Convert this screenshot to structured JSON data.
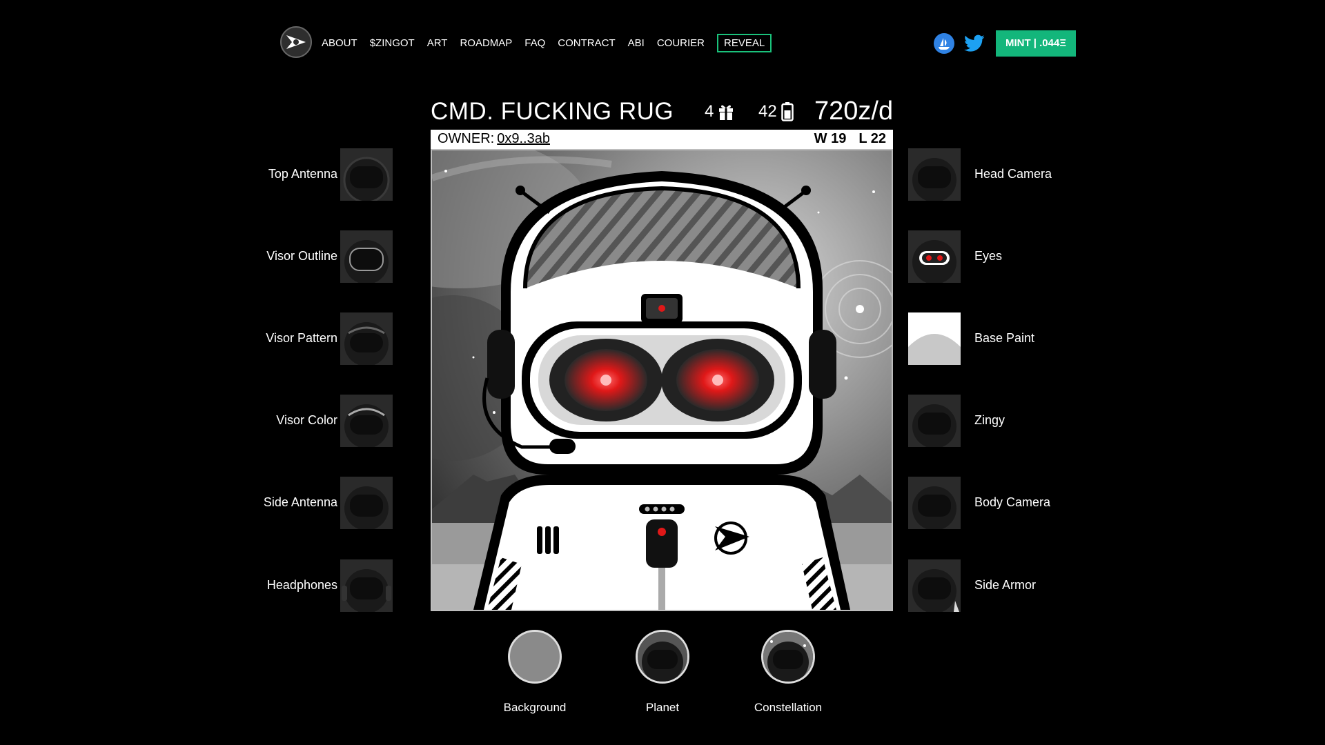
{
  "nav": {
    "logo_icon": "zingy-rocket-logo-icon",
    "items": [
      "ABOUT",
      "$ZINGOT",
      "ART",
      "ROADMAP",
      "FAQ",
      "CONTRACT",
      "ABI",
      "COURIER"
    ],
    "reveal_label": "REVEAL",
    "opensea_icon": "opensea-icon",
    "twitter_icon": "twitter-icon",
    "mint_label": "MINT | .044Ξ",
    "accent": "#13b67b"
  },
  "header": {
    "title": "CMD. FUCKING RUG",
    "gifts": "4",
    "gift_icon": "gift-icon",
    "battery": "42",
    "battery_icon": "battery-icon",
    "rate": "720z/d"
  },
  "owner": {
    "label": "OWNER:",
    "address": "0x9..3ab",
    "wins": "W 19",
    "losses": "L 22"
  },
  "traits_left": [
    {
      "label": "Top Antenna"
    },
    {
      "label": "Visor Outline"
    },
    {
      "label": "Visor Pattern"
    },
    {
      "label": "Visor Color"
    },
    {
      "label": "Side Antenna"
    },
    {
      "label": "Headphones"
    }
  ],
  "traits_right": [
    {
      "label": "Head Camera"
    },
    {
      "label": "Eyes"
    },
    {
      "label": "Base Paint"
    },
    {
      "label": "Zingy"
    },
    {
      "label": "Body Camera"
    },
    {
      "label": "Side Armor"
    }
  ],
  "bottom": [
    {
      "label": "Background"
    },
    {
      "label": "Planet"
    },
    {
      "label": "Constellation"
    }
  ],
  "colors": {
    "eye_red": "#e01818",
    "opensea_blue": "#2f82e4",
    "twitter_blue": "#1da1f2"
  }
}
